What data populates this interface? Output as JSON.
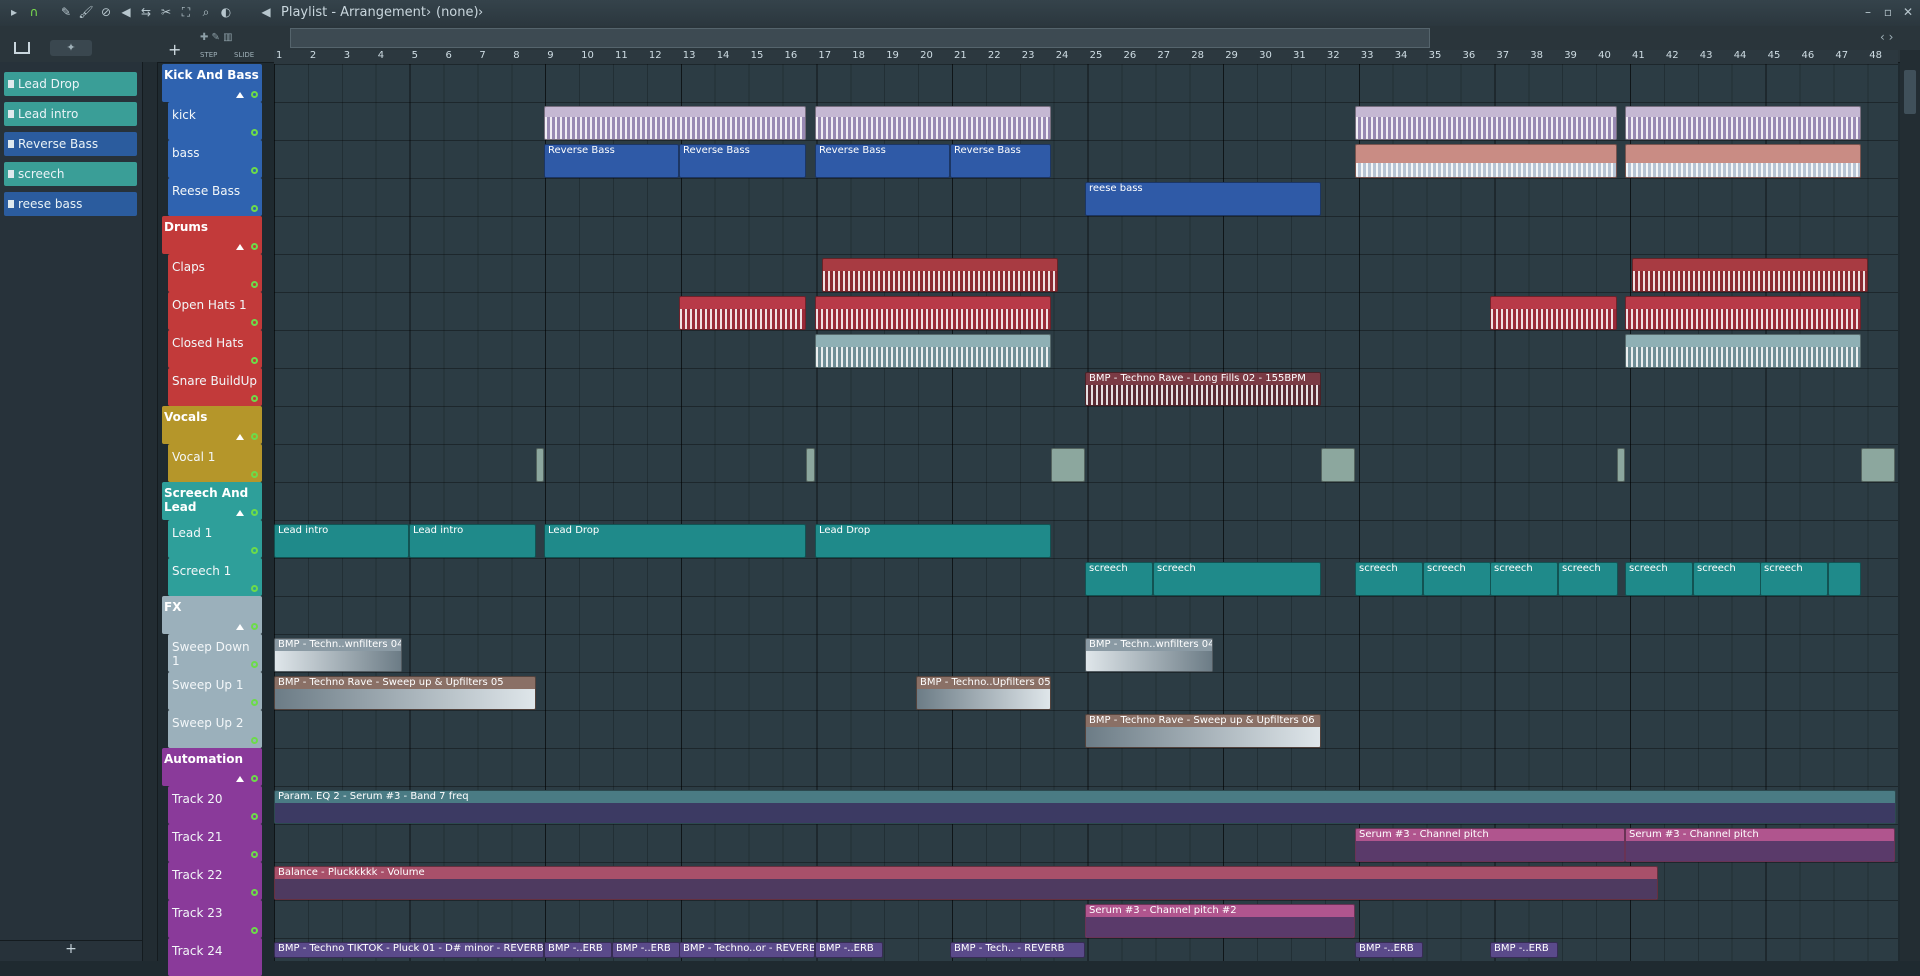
{
  "window": {
    "title": "Playlist - Arrangement",
    "breadcrumb_sep": "›",
    "pattern": "(none)"
  },
  "toolbar": {
    "step_label": "STEP",
    "slide_label": "SLIDE"
  },
  "browser": {
    "items": [
      {
        "label": "Lead Drop",
        "color": "#3a9e97"
      },
      {
        "label": "Lead intro",
        "color": "#3a9e97"
      },
      {
        "label": "Reverse Bass",
        "color": "#2b5c9e"
      },
      {
        "label": "screech",
        "color": "#3a9e97"
      },
      {
        "label": "reese bass",
        "color": "#2b5c9e"
      }
    ],
    "add_label": "+"
  },
  "ruler": {
    "bars": [
      "1",
      "2",
      "3",
      "4",
      "5",
      "6",
      "7",
      "8",
      "9",
      "10",
      "11",
      "12",
      "13",
      "14",
      "15",
      "16",
      "17",
      "18",
      "19",
      "20",
      "21",
      "22",
      "23",
      "24",
      "25",
      "26",
      "27",
      "28",
      "29",
      "30",
      "31",
      "32",
      "33",
      "34",
      "35",
      "36",
      "37",
      "38",
      "39",
      "40",
      "41",
      "42",
      "43",
      "44",
      "45",
      "46",
      "47",
      "48"
    ]
  },
  "groups": [
    {
      "label": "Kick And Bass",
      "color": "#2f63b0"
    },
    {
      "label": "Drums",
      "color": "#c23a3a"
    },
    {
      "label": "Vocals",
      "color": "#b5962a"
    },
    {
      "label": "Screech And Lead",
      "color": "#2e9f9a"
    },
    {
      "label": "FX",
      "color": "#9bb0bb"
    },
    {
      "label": "Automation",
      "color": "#8a3a9a"
    }
  ],
  "tracks": [
    {
      "label": "Kick And Bass"
    },
    {
      "label": "kick"
    },
    {
      "label": "bass"
    },
    {
      "label": "Reese Bass"
    },
    {
      "label": "Drums"
    },
    {
      "label": "Claps"
    },
    {
      "label": "Open Hats 1"
    },
    {
      "label": "Closed Hats"
    },
    {
      "label": "Snare BuildUp"
    },
    {
      "label": "Vocals"
    },
    {
      "label": "Vocal 1"
    },
    {
      "label": "Screech And Lead"
    },
    {
      "label": "Lead 1"
    },
    {
      "label": "Screech 1"
    },
    {
      "label": "FX"
    },
    {
      "label": "Sweep Down 1"
    },
    {
      "label": "Sweep Up 1"
    },
    {
      "label": "Sweep Up 2"
    },
    {
      "label": "Automation"
    },
    {
      "label": "Track 20"
    },
    {
      "label": "Track 21"
    },
    {
      "label": "Track 22"
    },
    {
      "label": "Track 23"
    },
    {
      "label": "Track 24"
    }
  ],
  "clips": {
    "reverse_bass": "Reverse Bass",
    "reese": "reese bass",
    "snare_fill": "BMP - Techno Rave - Long Fills 02 - 155BPM",
    "lead_intro": "Lead intro",
    "lead_drop": "Lead Drop",
    "screech": "screech",
    "sweep_down": "BMP - Techn..wnfilters 04",
    "sweep_up_05": "BMP - Techno Rave - Sweep up & Upfilters 05",
    "sweep_up_05_short": "BMP - Techno..Upfilters 05",
    "sweep_up_06": "BMP - Techno Rave - Sweep up & Upfilters 06",
    "eq": "Param. EQ 2 - Serum #3 - Band 7 freq",
    "pitch": "Serum #3 - Channel pitch",
    "balance": "Balance - Pluckkkkk - Volume",
    "pitch2": "Serum #3 - Channel pitch #2",
    "tiktok": "BMP - Techno TIKTOK - Pluck 01 - D# minor - REVERB",
    "erb1": "BMP -..ERB",
    "techno_or": "BMP - Techno..or - REVERB",
    "tech_reverb": "BMP - Tech.. - REVERB"
  }
}
